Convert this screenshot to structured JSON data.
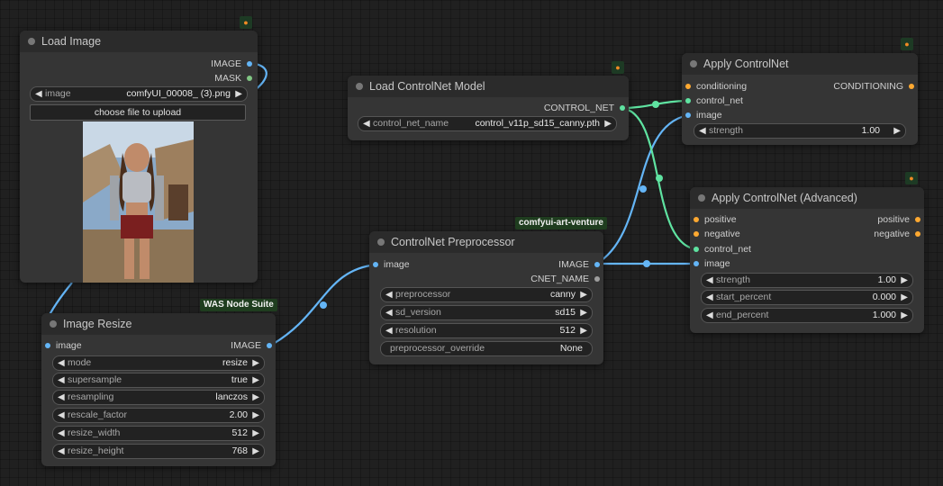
{
  "nodes": {
    "load_image": {
      "title": "Load Image",
      "outputs": [
        "IMAGE",
        "MASK"
      ],
      "widget_image": {
        "label": "image",
        "value": "comfyUI_00008_ (3).png"
      },
      "upload_label": "choose file to upload"
    },
    "image_resize": {
      "badge": "WAS Node Suite",
      "title": "Image Resize",
      "input": "image",
      "output": "IMAGE",
      "widgets": [
        {
          "label": "mode",
          "value": "resize"
        },
        {
          "label": "supersample",
          "value": "true"
        },
        {
          "label": "resampling",
          "value": "lanczos"
        },
        {
          "label": "rescale_factor",
          "value": "2.00"
        },
        {
          "label": "resize_width",
          "value": "512"
        },
        {
          "label": "resize_height",
          "value": "768"
        }
      ]
    },
    "load_controlnet": {
      "title": "Load ControlNet Model",
      "output": "CONTROL_NET",
      "widget": {
        "label": "control_net_name",
        "value": "control_v11p_sd15_canny.pth"
      }
    },
    "preprocessor": {
      "badge": "comfyui-art-venture",
      "title": "ControlNet Preprocessor",
      "input": "image",
      "outputs": [
        "IMAGE",
        "CNET_NAME"
      ],
      "widgets": [
        {
          "label": "preprocessor",
          "value": "canny"
        },
        {
          "label": "sd_version",
          "value": "sd15"
        },
        {
          "label": "resolution",
          "value": "512"
        }
      ],
      "text_widget": {
        "label": "preprocessor_override",
        "value": "None"
      }
    },
    "apply_controlnet": {
      "title": "Apply ControlNet",
      "inputs": [
        "conditioning",
        "control_net",
        "image"
      ],
      "output": "CONDITIONING",
      "widget": {
        "label": "strength",
        "value": "1.00"
      }
    },
    "apply_controlnet_adv": {
      "title": "Apply ControlNet (Advanced)",
      "inputs": [
        "positive",
        "negative",
        "control_net",
        "image"
      ],
      "outputs": [
        "positive",
        "negative"
      ],
      "widgets": [
        {
          "label": "strength",
          "value": "1.00"
        },
        {
          "label": "start_percent",
          "value": "0.000"
        },
        {
          "label": "end_percent",
          "value": "1.000"
        }
      ]
    }
  },
  "colors": {
    "image_wire": "#64b5f6",
    "control_net_wire": "#5fe3a1",
    "conditioning_pin": "#ffa931",
    "mask_pin": "#81c784",
    "badge_bg": "#1f3d1f"
  },
  "icons": {
    "node_badge": "fox-icon",
    "node_status": "dot-icon",
    "widget_prev": "triangle-left-icon",
    "widget_next": "triangle-right-icon"
  }
}
